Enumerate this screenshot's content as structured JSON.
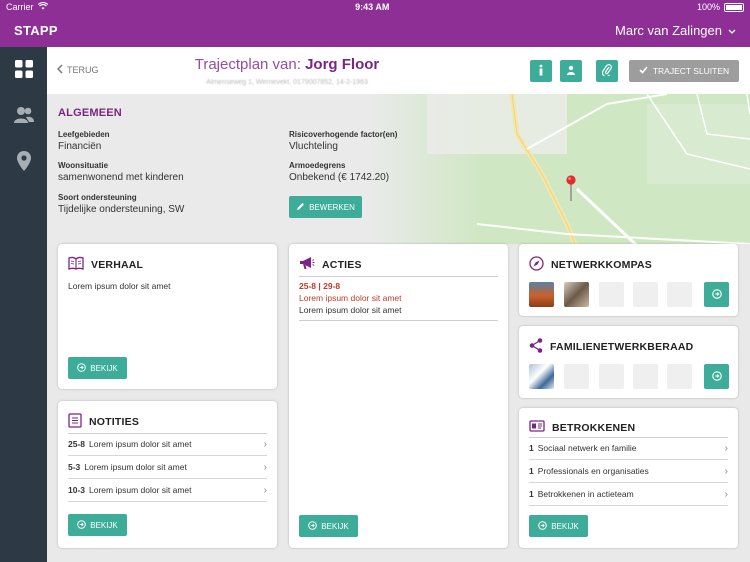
{
  "status_bar": {
    "carrier": "Carrier",
    "time": "9:43 AM",
    "battery": "100%"
  },
  "app_bar": {
    "app_name": "STAPP",
    "user_name": "Marc van Zalingen"
  },
  "header": {
    "back_label": "TERUG",
    "title_prefix": "Trajectplan van:",
    "title_name": "Jorg Floor",
    "address": "Almenseweg 1, Wernevekt, 0179007852, 14-2-1963",
    "close_label": "TRAJECT SLUITEN"
  },
  "general": {
    "title": "ALGEMEEN",
    "fields": [
      {
        "label": "Leefgebieden",
        "value": "Financiën"
      },
      {
        "label": "Woonsituatie",
        "value": "samenwonend met kinderen"
      },
      {
        "label": "Soort ondersteuning",
        "value": "Tijdelijke ondersteuning, SW"
      },
      {
        "label": "Risicoverhogende factor(en)",
        "value": "Vluchteling"
      },
      {
        "label": "Armoedegrens",
        "value": "Onbekend (€ 1742.20)"
      }
    ],
    "edit_label": "BEWERKEN"
  },
  "verhaal": {
    "title": "VERHAAL",
    "text": "Lorem ipsum dolor sit amet",
    "button": "BEKIJK"
  },
  "notities": {
    "title": "NOTITIES",
    "items": [
      {
        "date": "25-8",
        "text": "Lorem ipsum dolor sit amet"
      },
      {
        "date": "5-3",
        "text": "Lorem ipsum dolor sit amet"
      },
      {
        "date": "10-3",
        "text": "Lorem ipsum dolor sit amet"
      }
    ],
    "button": "BEKIJK"
  },
  "acties": {
    "title": "ACTIES",
    "date_range": "25-8 | 29-8",
    "line1": "Lorem ipsum dolor sit amet",
    "line2": "Lorem ipsum dolor sit amet",
    "button": "BEKIJK"
  },
  "netwerkkompas": {
    "title": "NETWERKKOMPAS"
  },
  "familie": {
    "title": "FAMILIENETWERKBERAAD"
  },
  "betrokkenen": {
    "title": "BETROKKENEN",
    "items": [
      {
        "count": "1",
        "text": "Sociaal netwerk en familie"
      },
      {
        "count": "1",
        "text": "Professionals en organisaties"
      },
      {
        "count": "1",
        "text": "Betrokkenen in actieteam"
      }
    ],
    "button": "BEKIJK"
  },
  "colors": {
    "brand": "#8e2f96",
    "accent": "#3dac98",
    "nav": "#2d3a45",
    "alert": "#c0392b"
  }
}
